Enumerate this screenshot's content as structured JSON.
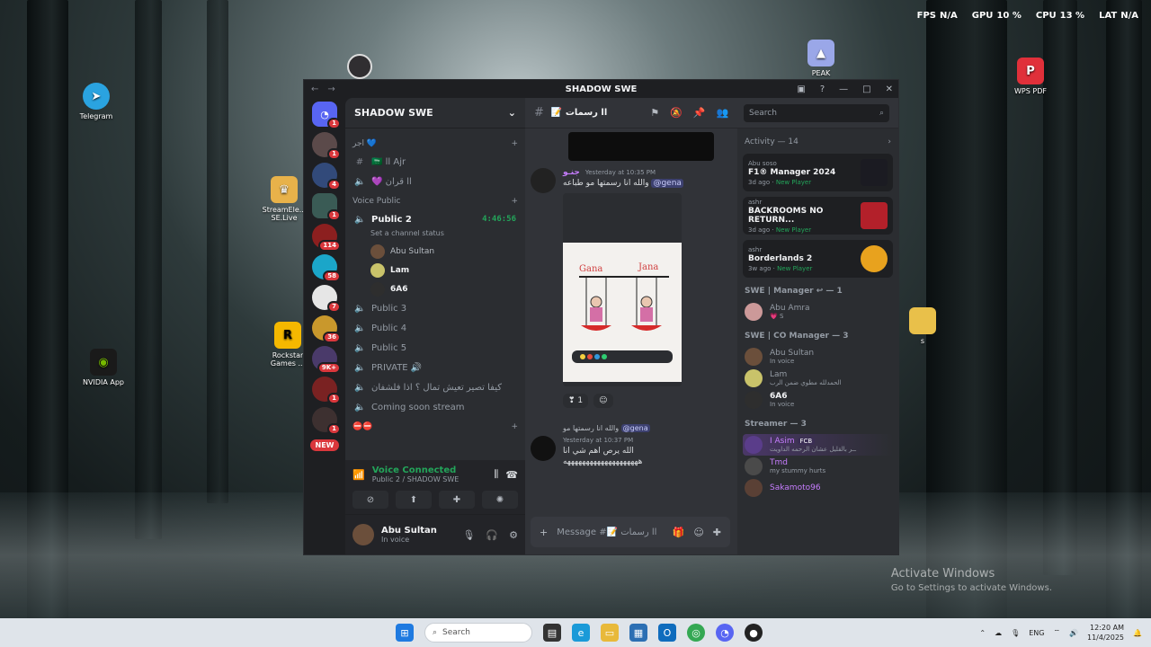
{
  "overlay": {
    "fps_label": "FPS",
    "fps": "N/A",
    "gpu_label": "GPU",
    "gpu": "10 %",
    "cpu_label": "CPU",
    "cpu": "13 %",
    "lat_label": "LAT",
    "lat": "N/A"
  },
  "desktop": {
    "telegram": "Telegram",
    "streamelements": "StreamEle... SE.Live",
    "rockstar": "Rockstar Games ...",
    "nvidia": "NVIDIA App",
    "peak": "PEAK",
    "wps": "WPS PDF",
    "s_folder": "s",
    "activate_title": "Activate Windows",
    "activate_sub": "Go to Settings to activate Windows."
  },
  "window": {
    "title": "SHADOW SWE"
  },
  "guilds": {
    "badges": [
      "1",
      "1",
      "4",
      "1",
      "114",
      "58",
      "7",
      "36",
      "9K+",
      "1",
      "1"
    ],
    "new_label": "NEW"
  },
  "server": {
    "name": "SHADOW SWE",
    "cat1": "اجر 💙",
    "ch_ajr": "🇸🇦 ll Ajr",
    "ch_quran": "💜 قران ll",
    "voice_cat": "Voice Public",
    "public2": "Public 2",
    "timer": "4:46:56",
    "status_hint": "Set a channel status",
    "vu1": "Abu Sultan",
    "vu2": "Lam",
    "vu3_tag": "6A6",
    "public3": "Public 3",
    "public4": "Public 4",
    "public5": "Public 5",
    "private": "PRIVATE 🔊",
    "arabic_ch": "كيفا تصير تعيش تمال ؟ اذا فلشفان",
    "soon": "Coming soon stream",
    "cat_last": "⛔⛔"
  },
  "voice_panel": {
    "status": "Voice Connected",
    "channel": "Public 2 / SHADOW SWE"
  },
  "user": {
    "name": "Abu Sultan",
    "status": "In voice"
  },
  "chat": {
    "channel": "📝 رسمات ll",
    "search_placeholder": "Search",
    "msg1_author": "جنـو",
    "msg1_time": "Yesterday at 10:35 PM",
    "msg1_mention": "@gena",
    "msg1_text": "والله انا رسمتها مو طباعه",
    "drawing_left": "Gana",
    "drawing_right": "Jana",
    "react_count": "1",
    "reply_mention": "@gena",
    "reply_text": "والله انا رسمتها مو",
    "msg2_time": "Yesterday at 10:37 PM",
    "msg2_line1": "الله يرص اهم شي انا",
    "msg2_line2": "ههههههههههههههههههههه",
    "composer_placeholder": "Message #📝 رسمات ll"
  },
  "members": {
    "activity_label": "Activity — 14",
    "acts": [
      {
        "user": "Abu soso",
        "game": "F1® Manager 2024",
        "ago": "3d ago",
        "tag": "New Player"
      },
      {
        "user": "ashr",
        "game": "BACKROOMS NO RETURN...",
        "ago": "3d ago",
        "tag": "New Player"
      },
      {
        "user": "ashr",
        "game": "Borderlands 2",
        "ago": "3w ago",
        "tag": "New Player"
      }
    ],
    "cat_manager": "SWE | Manager ↩ — 1",
    "manager1": "Abu Amra",
    "manager1_status": "💗 S",
    "cat_co": "SWE | CO Manager — 3",
    "co1": "Abu Sultan",
    "co1_status": "In voice",
    "co2": "Lam",
    "co2_status": "الحمدلله مطوي ضمن الرب",
    "co3_tag": "6A6",
    "co3_status": "In voice",
    "cat_streamer": "Streamer — 3",
    "st1": "I Asim",
    "st1_tag": "FCB",
    "st1_status": "ــر بالقليل عشان الرحمه الداويت",
    "st2": "Tmd",
    "st2_status": "my stummy hurts",
    "st3": "Sakamoto96"
  },
  "taskbar": {
    "search_placeholder": "Search",
    "lang": "ENG",
    "time": "12:20 AM",
    "date": "11/4/2025"
  }
}
